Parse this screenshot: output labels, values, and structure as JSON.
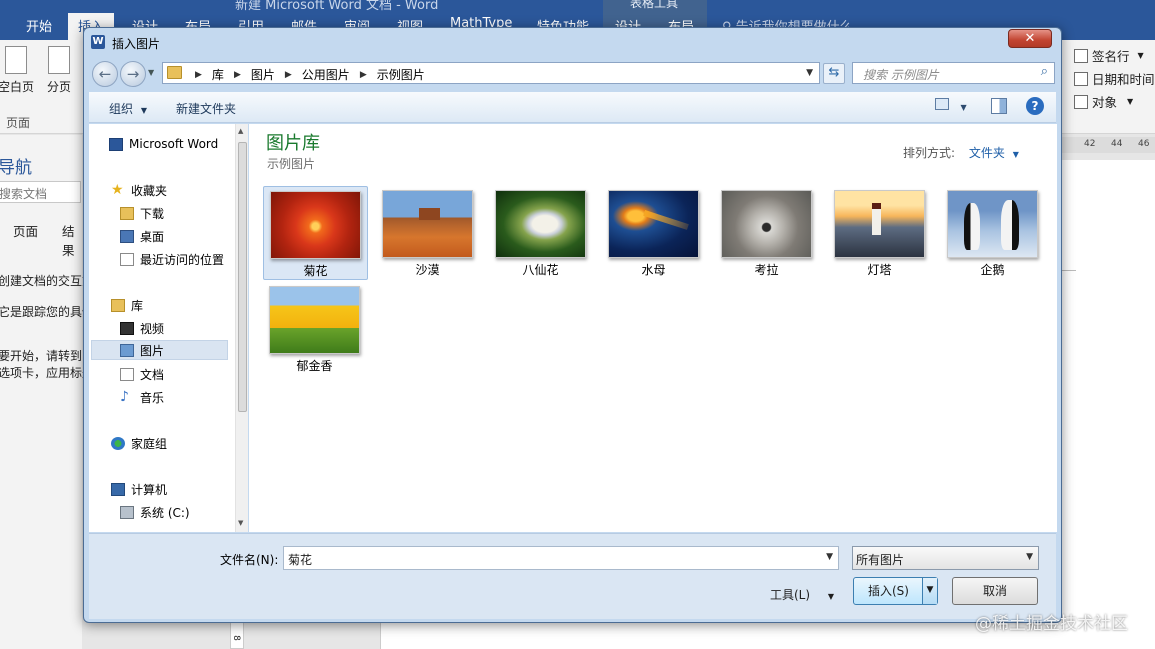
{
  "word": {
    "title": "新建 Microsoft Word 文档 - Word",
    "context_title": "表格工具",
    "tabs": [
      "开始",
      "插入",
      "设计",
      "布局",
      "引用",
      "邮件",
      "审阅",
      "视图",
      "MathType",
      "特色功能",
      "设计",
      "布局"
    ],
    "tell_me": "告诉我你想要做什么",
    "ribbon": {
      "blank_page": "空白页",
      "page_break": "分页",
      "pages_group": "页面",
      "signature_line": "签名行",
      "date_time": "日期和时间",
      "object": "对象"
    },
    "nav": {
      "title": "导航",
      "search_placeholder": "搜索文档",
      "tab_pages": "页面",
      "tab_results": "结果",
      "text_1": "创建文档的交互式大纲。",
      "text_2": "它是跟踪您的具体位置",
      "text_3": "要开始，请转到\"开始\"",
      "text_4": "选项卡，应用标题样式。"
    },
    "ruler_numbers": [
      "42",
      "44",
      "46"
    ],
    "vruler_mark": "8"
  },
  "dialog": {
    "title": "插入图片",
    "close": "✕",
    "breadcrumb": [
      "库",
      "图片",
      "公用图片",
      "示例图片"
    ],
    "search_placeholder": "搜索 示例图片",
    "toolbar": {
      "organize": "组织",
      "new_folder": "新建文件夹"
    },
    "tree": {
      "word": "Microsoft Word",
      "favorites": "收藏夹",
      "downloads": "下载",
      "desktop": "桌面",
      "recent": "最近访问的位置",
      "libraries": "库",
      "videos": "视频",
      "pictures": "图片",
      "documents": "文档",
      "music": "音乐",
      "homegroup": "家庭组",
      "computer": "计算机",
      "system_drive": "系统 (C:)"
    },
    "library_title": "图片库",
    "library_subtitle": "示例图片",
    "arrange_label": "排列方式:",
    "arrange_value": "文件夹",
    "images": [
      "菊花",
      "沙漠",
      "八仙花",
      "水母",
      "考拉",
      "灯塔",
      "企鹅",
      "郁金香"
    ],
    "selected_image": "菊花",
    "filename_label": "文件名(N):",
    "filename_value": "菊花",
    "filter_value": "所有图片",
    "tools_label": "工具(L)",
    "insert_label": "插入(S)",
    "cancel_label": "取消"
  },
  "watermark": "@稀土掘金技术社区"
}
